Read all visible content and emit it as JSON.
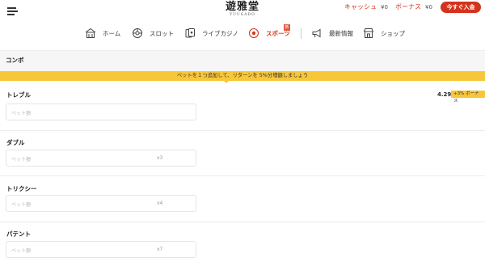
{
  "header": {
    "logo_kanji": "遊雅堂",
    "logo_roman": "YUUGADO",
    "cash_label": "キャッシュ",
    "cash_value": "¥0",
    "bonus_label": "ボーナス",
    "bonus_value": "¥0",
    "deposit_button": "今すぐ入金"
  },
  "nav": {
    "items": [
      {
        "label": "ホーム",
        "icon": "home-icon"
      },
      {
        "label": "スロット",
        "icon": "slot-icon"
      },
      {
        "label": "ライブカジノ",
        "icon": "live-casino-icon"
      },
      {
        "label": "スポーツ",
        "icon": "sports-icon",
        "active": true
      },
      {
        "label": "最新情報",
        "icon": "megaphone-icon"
      },
      {
        "label": "ショップ",
        "icon": "shop-icon"
      }
    ],
    "new_badge": "新"
  },
  "betslip": {
    "section_title": "コンボ",
    "promo_text": "ベットを１つ追加して、リターンを 5%分増額しましょう",
    "odds": "4.29",
    "bonus_tag": "+3% ボーナス",
    "rows": [
      {
        "title": "トレブル",
        "placeholder": "ベット額",
        "multiplier": ""
      },
      {
        "title": "ダブル",
        "placeholder": "ベット額",
        "multiplier": "x3"
      },
      {
        "title": "トリクシー",
        "placeholder": "ベット額",
        "multiplier": "x4"
      },
      {
        "title": "パテント",
        "placeholder": "ベット額",
        "multiplier": "x7"
      }
    ]
  },
  "colors": {
    "brand_red": "#d3331d",
    "promo_yellow": "#f7c739"
  }
}
